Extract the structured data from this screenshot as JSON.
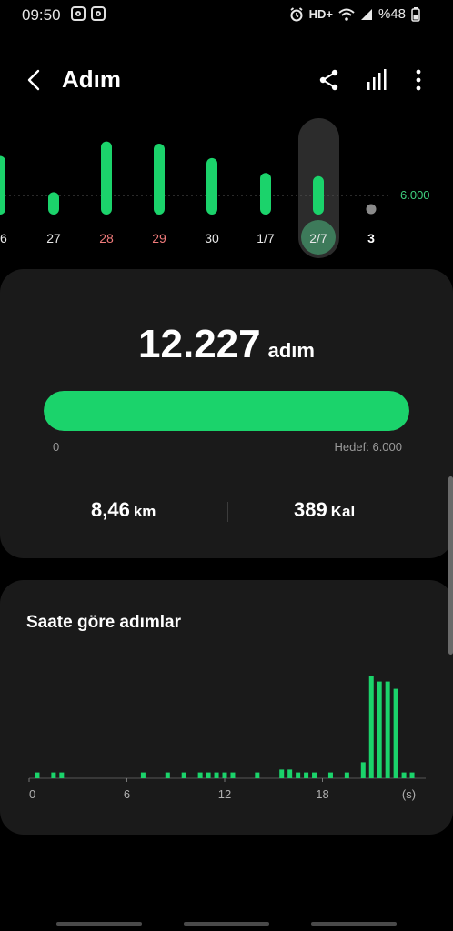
{
  "status_bar": {
    "time": "09:50",
    "network": "HD+",
    "battery": "%48"
  },
  "header": {
    "title": "Adım",
    "back_icon": "chevron-left-icon",
    "share_icon": "share-icon",
    "chart_icon": "bar-chart-icon",
    "more_icon": "more-vertical-icon"
  },
  "week_chart": {
    "goal_label": "6.000",
    "days": [
      {
        "label": "26",
        "color": "#e8e8e8"
      },
      {
        "label": "27",
        "color": "#e8e8e8"
      },
      {
        "label": "28",
        "color": "#f07b7b"
      },
      {
        "label": "29",
        "color": "#f07b7b"
      },
      {
        "label": "30",
        "color": "#e8e8e8"
      },
      {
        "label": "1/7",
        "color": "#e8e8e8"
      },
      {
        "label": "2/7",
        "color": "#e8e8e8"
      },
      {
        "label": "3",
        "color": "#ffffff"
      }
    ],
    "accent": "#1bd36b"
  },
  "summary": {
    "steps": "12.227",
    "steps_unit": "adım",
    "progress_fraction": 1.0,
    "progress_min": "0",
    "progress_goal": "Hedef: 6.000",
    "distance_value": "8,46",
    "distance_unit": "km",
    "calories_value": "389",
    "calories_unit": "Kal"
  },
  "hourly": {
    "title": "Saate göre adımlar",
    "accent": "#1bd36b"
  },
  "chart_data": [
    {
      "type": "bar",
      "categories": [
        "26",
        "27",
        "28",
        "29",
        "30",
        "1/7",
        "2/7",
        "3"
      ],
      "values": [
        11000,
        4200,
        13700,
        13300,
        10600,
        7800,
        7200,
        0
      ],
      "goal": 6000,
      "selected": "2/7",
      "xlabel": "",
      "ylabel": "",
      "ylim": [
        0,
        15000
      ]
    },
    {
      "type": "bar",
      "title": "Saate göre adımlar",
      "x_ticks": [
        "0",
        "6",
        "12",
        "18",
        "(s)"
      ],
      "xlim": [
        0,
        24
      ],
      "x": [
        0.5,
        1.5,
        2.0,
        7.0,
        8.5,
        9.5,
        10.5,
        11.0,
        11.5,
        12.0,
        12.5,
        14.0,
        15.5,
        16.0,
        16.5,
        17.0,
        17.5,
        18.5,
        19.5,
        20.5,
        21.0,
        21.5,
        22.0,
        22.5,
        23.0,
        23.5
      ],
      "values": [
        80,
        80,
        80,
        80,
        80,
        80,
        80,
        80,
        80,
        80,
        80,
        80,
        120,
        120,
        80,
        80,
        80,
        80,
        80,
        220,
        1400,
        1330,
        1330,
        1230,
        80,
        80
      ],
      "xlabel": "",
      "ylabel": "",
      "ylim": [
        0,
        1500
      ]
    }
  ]
}
